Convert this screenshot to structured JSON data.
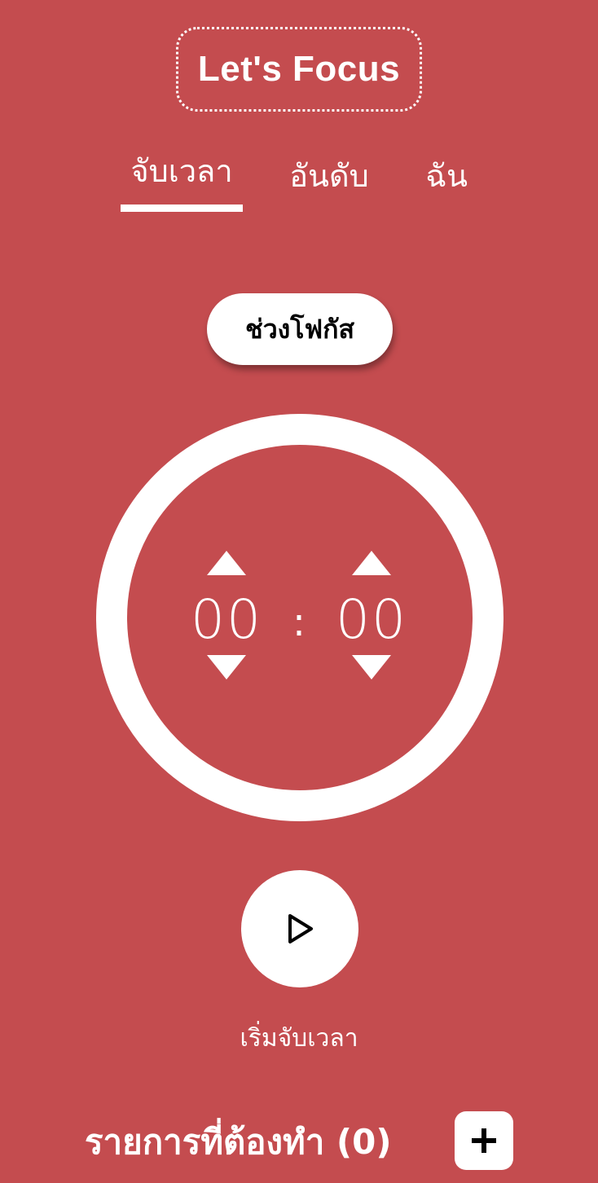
{
  "app": {
    "title": "Let's Focus"
  },
  "tabs": [
    {
      "label": "จับเวลา",
      "active": true
    },
    {
      "label": "อันดับ",
      "active": false
    },
    {
      "label": "ฉัน",
      "active": false
    }
  ],
  "mode": {
    "label": "ช่วงโฟกัส"
  },
  "timer": {
    "minutes": "00",
    "separator": ":",
    "seconds": "00"
  },
  "controls": {
    "start_label": "เริ่มจับเวลา"
  },
  "todo": {
    "title": "รายการที่ต้องทำ (0)"
  },
  "icons": {
    "play": "play-icon",
    "add": "plus-icon",
    "increment": "triangle-up-icon",
    "decrement": "triangle-down-icon"
  },
  "colors": {
    "background": "#c44c4f",
    "foreground": "#ffffff",
    "icon": "#000000"
  }
}
